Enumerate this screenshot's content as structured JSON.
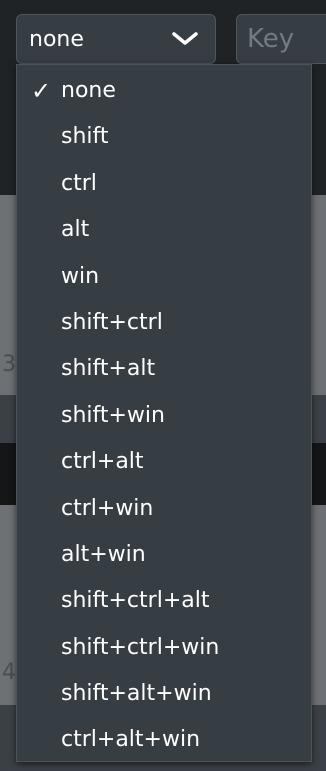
{
  "modifier_select": {
    "value": "none",
    "chevron_icon": "chevron-down-icon"
  },
  "key_input": {
    "placeholder": "Key",
    "value": ""
  },
  "dropdown": {
    "check_icon": "✓",
    "selected": "none",
    "options": [
      "none",
      "shift",
      "ctrl",
      "alt",
      "win",
      "shift+ctrl",
      "shift+alt",
      "shift+win",
      "ctrl+alt",
      "ctrl+win",
      "alt+win",
      "shift+ctrl+alt",
      "shift+ctrl+win",
      "shift+alt+win",
      "ctrl+alt+win"
    ]
  },
  "background": {
    "edge_digits": [
      "3",
      "4"
    ]
  }
}
